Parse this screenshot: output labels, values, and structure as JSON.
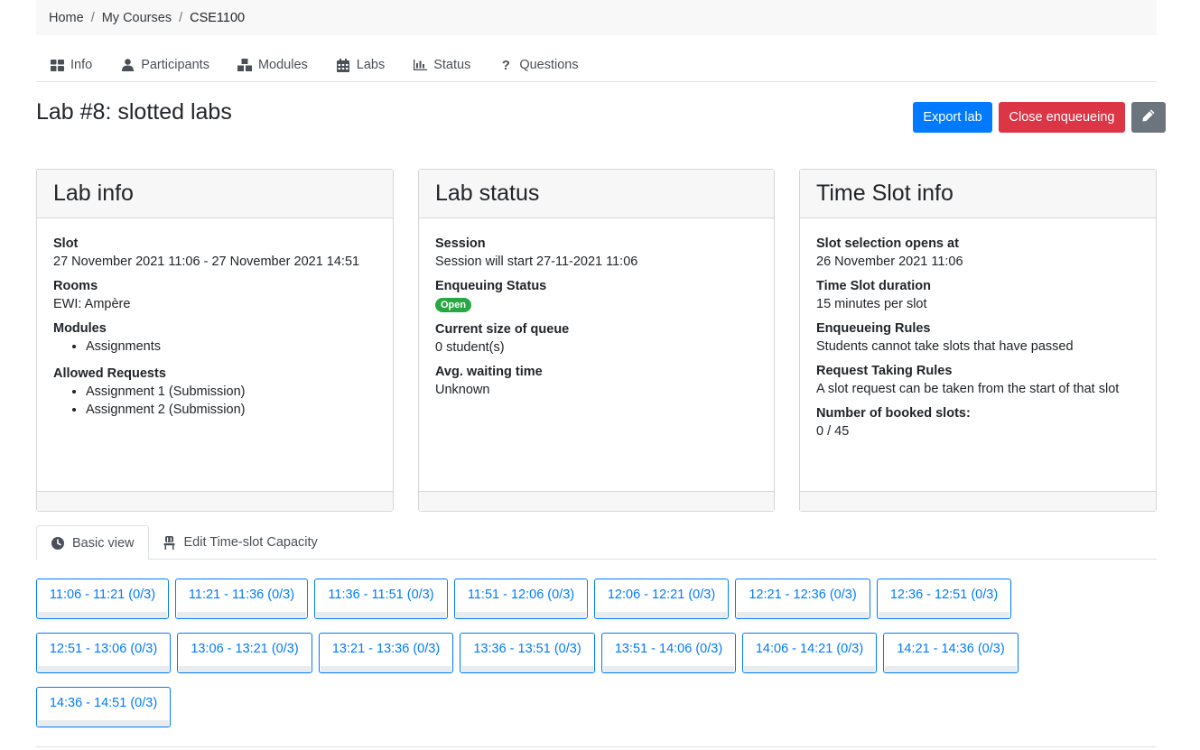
{
  "breadcrumb": {
    "home": "Home",
    "sep": "/",
    "courses": "My Courses",
    "current": "CSE1100"
  },
  "nav": {
    "info": "Info",
    "participants": "Participants",
    "modules": "Modules",
    "labs": "Labs",
    "status": "Status",
    "questions": "Questions"
  },
  "page": {
    "title": "Lab #8: slotted labs"
  },
  "actions": {
    "export": "Export lab",
    "close": "Close enqueueing",
    "edit_icon": "pencil-icon"
  },
  "lab_info": {
    "header": "Lab info",
    "slot_label": "Slot",
    "slot_value": "27 November 2021 11:06 - 27 November 2021 14:51",
    "rooms_label": "Rooms",
    "rooms_value": "EWI: Ampère",
    "modules_label": "Modules",
    "modules": [
      "Assignments"
    ],
    "requests_label": "Allowed Requests",
    "requests": [
      "Assignment 1 (Submission)",
      "Assignment 2 (Submission)"
    ]
  },
  "lab_status": {
    "header": "Lab status",
    "session_label": "Session",
    "session_value": "Session will start 27-11-2021 11:06",
    "enqueue_label": "Enqueuing Status",
    "enqueue_badge": "Open",
    "queue_label": "Current size of queue",
    "queue_value": "0 student(s)",
    "wait_label": "Avg. waiting time",
    "wait_value": "Unknown"
  },
  "slot_info": {
    "header": "Time Slot info",
    "opens_label": "Slot selection opens at",
    "opens_value": "26 November 2021 11:06",
    "duration_label": "Time Slot duration",
    "duration_value": "15 minutes per slot",
    "enq_rules_label": "Enqueueing Rules",
    "enq_rules_value": "Students cannot take slots that have passed",
    "req_rules_label": "Request Taking Rules",
    "req_rules_value": "A slot request can be taken from the start of that slot",
    "booked_label": "Number of booked slots:",
    "booked_value": "0 / 45"
  },
  "view_tabs": {
    "basic": "Basic view",
    "capacity": "Edit Time-slot Capacity"
  },
  "slots": [
    [
      "11:06 - 11:21 (0/3)",
      "11:21 - 11:36 (0/3)",
      "11:36 - 11:51 (0/3)",
      "11:51 - 12:06 (0/3)",
      "12:06 - 12:21 (0/3)",
      "12:21 - 12:36 (0/3)",
      "12:36 - 12:51 (0/3)"
    ],
    [
      "12:51 - 13:06 (0/3)",
      "13:06 - 13:21 (0/3)",
      "13:21 - 13:36 (0/3)",
      "13:36 - 13:51 (0/3)",
      "13:51 - 14:06 (0/3)",
      "14:06 - 14:21 (0/3)",
      "14:21 - 14:36 (0/3)"
    ],
    [
      "14:36 - 14:51 (0/3)"
    ]
  ],
  "colors": {
    "primary": "#007bff",
    "danger": "#dc3545",
    "secondary": "#6c757d",
    "success": "#28a745"
  }
}
